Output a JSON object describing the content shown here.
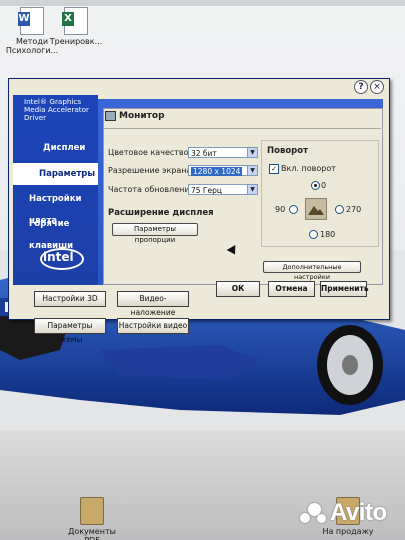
{
  "desktop": {
    "icons": [
      {
        "label": "Методи Психологи...",
        "icon": "word-document-icon"
      },
      {
        "label": "Тренировк...",
        "icon": "excel-document-icon"
      },
      {
        "label": "Документы PDF",
        "icon": "folder-icon"
      },
      {
        "label": "На продажу",
        "icon": "folder-icon"
      }
    ],
    "watermark": "Avito"
  },
  "app": {
    "brand": "Intel® Graphics Media Accelerator Driver",
    "help": "?",
    "close": "×",
    "logo": "intel",
    "nav": [
      {
        "label": "Дисплеи",
        "active": false
      },
      {
        "label": "Параметры",
        "active": true
      },
      {
        "label": "Настройки цвета",
        "active": false
      },
      {
        "label": "Горячие клавиши",
        "active": false
      }
    ],
    "buttons_left": [
      "Настройки 3D",
      "Параметры схемы"
    ],
    "buttons_right": [
      "Видео-наложение",
      "Настройки видео"
    ]
  },
  "page": {
    "title": "Монитор",
    "color_quality": {
      "label": "Цветовое качество",
      "value": "32 бит"
    },
    "resolution": {
      "label": "Разрешение экрана",
      "value": "1280 x 1024"
    },
    "refresh": {
      "label": "Частота обновления",
      "value": "75 Герц"
    },
    "expansion_heading": "Расширение дисплея",
    "aspect_button": "Параметры пропорции",
    "rotation": {
      "heading": "Поворот",
      "enable_label": "Вкл. поворот",
      "enabled": true,
      "options": [
        "0",
        "90",
        "270",
        "180"
      ],
      "selected": "0"
    },
    "advanced_button": "Дополнительные настройки"
  },
  "dialog_buttons": {
    "ok": "ОК",
    "cancel": "Отмена",
    "apply": "Применить"
  },
  "colors": {
    "accent": "#1c44b9",
    "panel": "#ece9d8",
    "selection": "#316ac5"
  }
}
